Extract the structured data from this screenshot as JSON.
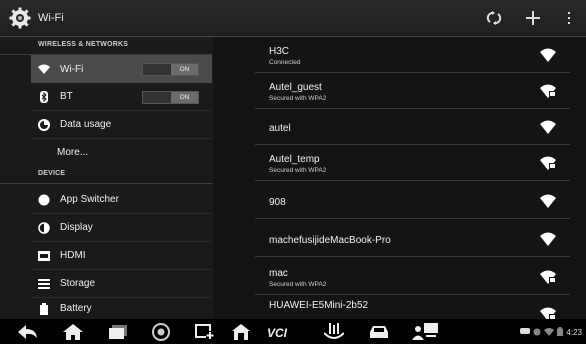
{
  "action_bar": {
    "title": "Wi-Fi",
    "icons": [
      "settings-gear-icon",
      "wps-icon",
      "add-icon",
      "overflow-menu-icon"
    ]
  },
  "settings": {
    "wireless_header": "WIRELESS & NETWORKS",
    "device_header": "DEVICE",
    "wifi": {
      "label": "Wi-Fi",
      "toggle": "ON",
      "icon": "wifi-icon"
    },
    "bt": {
      "label": "BT",
      "toggle": "ON",
      "icon": "bluetooth-icon"
    },
    "data_usage": {
      "label": "Data usage",
      "icon": "data-usage-icon"
    },
    "more": {
      "label": "More..."
    },
    "app_switcher": {
      "label": "App Switcher",
      "icon": "app-switcher-icon"
    },
    "display": {
      "label": "Display",
      "icon": "display-icon"
    },
    "hdmi": {
      "label": "HDMI",
      "icon": "hdmi-icon"
    },
    "storage": {
      "label": "Storage",
      "icon": "storage-icon"
    },
    "battery": {
      "label": "Battery",
      "icon": "battery-icon"
    }
  },
  "networks": [
    {
      "ssid": "H3C",
      "status": "Connected",
      "secured": false
    },
    {
      "ssid": "Autel_guest",
      "status": "Secured with WPA2",
      "secured": true
    },
    {
      "ssid": "autel",
      "status": "",
      "secured": false
    },
    {
      "ssid": "Autel_temp",
      "status": "Secured with WPA2",
      "secured": true
    },
    {
      "ssid": "908",
      "status": "",
      "secured": false
    },
    {
      "ssid": "machefusijideMacBook-Pro",
      "status": "",
      "secured": false
    },
    {
      "ssid": "mac",
      "status": "Secured with WPA2",
      "secured": true
    },
    {
      "ssid": "HUAWEI-E5Mini-2b52",
      "status": "",
      "secured": true
    }
  ],
  "navbar": {
    "icons": [
      "back-icon",
      "home-icon",
      "recent-apps-icon",
      "browser-icon",
      "screenshot-icon",
      "autel-home-icon",
      "vci-icon",
      "shop-icon",
      "car-icon",
      "remote-desk-icon"
    ],
    "time": "4:23"
  }
}
